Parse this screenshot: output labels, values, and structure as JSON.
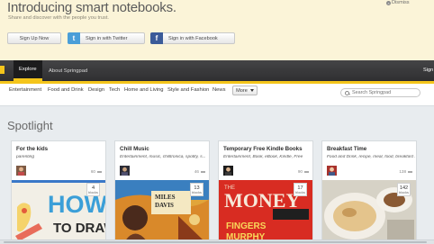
{
  "banner": {
    "title": "Introducing smart notebooks.",
    "subtitle": "Share and discover with the people you trust.",
    "dismiss": "Dismiss",
    "signup_label": "Sign Up Now",
    "twitter_label": "Sign in with Twitter",
    "facebook_label": "Sign in with Facebook"
  },
  "nav": {
    "tabs": [
      {
        "label": "Explore",
        "active": true
      },
      {
        "label": "About Springpad",
        "active": false
      }
    ],
    "right_label": "Sign"
  },
  "categories": {
    "items": [
      "Entertainment",
      "Food and Drink",
      "Design",
      "Tech",
      "Home and Living",
      "Style and Fashion",
      "News"
    ],
    "more_label": "More",
    "search_placeholder": "Search Springpad"
  },
  "spotlight": {
    "title": "Spotlight",
    "cards": [
      {
        "title": "For the kids",
        "tags": "parenting",
        "meta": "60",
        "count": "4",
        "count_label": "blocks",
        "art": "HOW TO DRAW"
      },
      {
        "title": "Chill Music",
        "tags": "Entertainment, music, chilltronica, spotify, s...",
        "meta": "46",
        "count": "13",
        "count_label": "blocks",
        "art": "MILES DAVIS"
      },
      {
        "title": "Temporary Free Kindle Books",
        "tags": "Entertainment, Book, eBook, Kindle, Free",
        "meta": "90",
        "count": "17",
        "count_label": "blocks",
        "art": "THE MONEY FINGERS MURPHY"
      },
      {
        "title": "Breakfast Time",
        "tags": "Food and Drink, recipe, meal, food, breakfast ...",
        "meta": "138",
        "count": "142",
        "count_label": "blocks",
        "art": ""
      }
    ]
  },
  "colors": {
    "banner_bg": "#fbf4d8",
    "nav_bg": "#38383a",
    "accent": "#f4c51b",
    "twitter": "#4a9ed8",
    "facebook": "#3b5b99"
  }
}
